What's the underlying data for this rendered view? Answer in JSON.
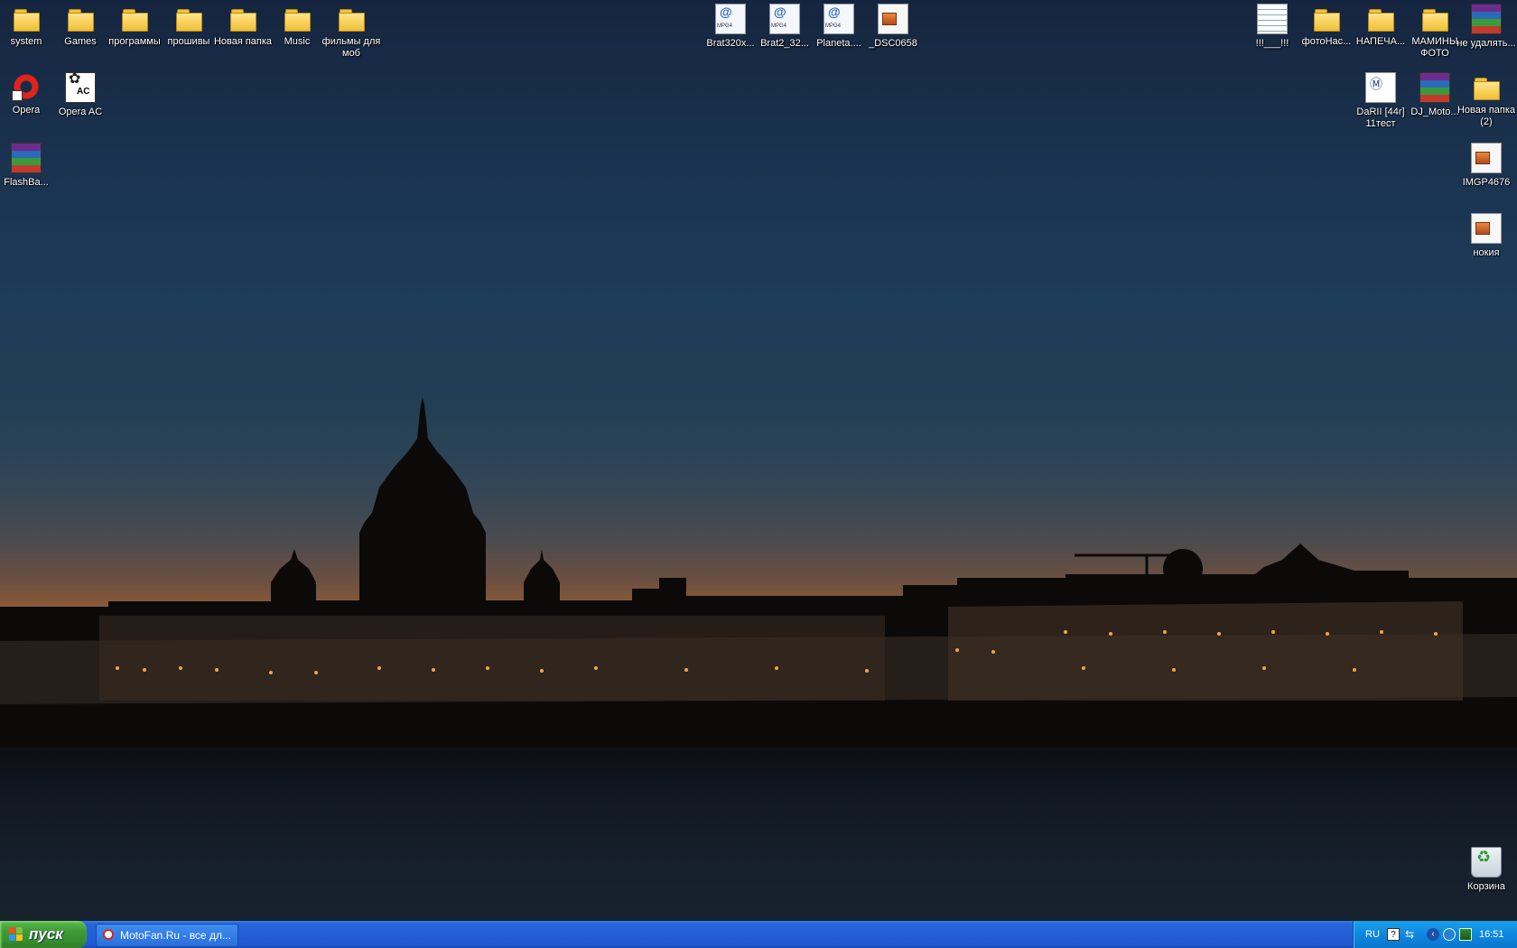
{
  "desktop": {
    "icons_left_top": [
      {
        "label": "system",
        "type": "folder"
      },
      {
        "label": "Games",
        "type": "folder"
      },
      {
        "label": "программы",
        "type": "folder"
      },
      {
        "label": "прошивы",
        "type": "folder"
      },
      {
        "label": "Новая папка",
        "type": "folder"
      },
      {
        "label": "Music",
        "type": "folder"
      },
      {
        "label": "фильмы для моб",
        "type": "folder"
      }
    ],
    "icons_left_col": [
      {
        "label": "Opera",
        "type": "opera"
      },
      {
        "label": "Opera AC",
        "type": "opera-ac"
      },
      {
        "label": "FlashBa...",
        "type": "rar"
      }
    ],
    "icons_center": [
      {
        "label": "Brat320x...",
        "type": "mpg"
      },
      {
        "label": "Brat2_32...",
        "type": "mpg"
      },
      {
        "label": "Planeta....",
        "type": "mpg"
      },
      {
        "label": "_DSC0658",
        "type": "image"
      }
    ],
    "icons_right_top": [
      {
        "label": "!!!___!!!",
        "type": "text"
      },
      {
        "label": "фотоНас...",
        "type": "folder"
      },
      {
        "label": "НАПЕЧА...",
        "type": "folder"
      },
      {
        "label": "МАМИНЫ ФОТО",
        "type": "folder"
      },
      {
        "label": "не удалять...",
        "type": "rar"
      }
    ],
    "icons_right_row2": [
      {
        "label": "DaRII [44r] 11тест",
        "type": "moto"
      },
      {
        "label": "DJ_Moto...",
        "type": "rar"
      },
      {
        "label": "Новая папка (2)",
        "type": "folder"
      }
    ],
    "icons_right_col": [
      {
        "label": "IMGP4676",
        "type": "image"
      },
      {
        "label": "нокия",
        "type": "image"
      }
    ],
    "recycle_bin": {
      "label": "Корзина"
    }
  },
  "taskbar": {
    "start_label": "пуск",
    "tasks": [
      {
        "label": "MotoFan.Ru - все дл..."
      }
    ],
    "tray": {
      "language": "RU",
      "clock": "16:51"
    }
  },
  "colors": {
    "taskbar_blue": "#245ed6",
    "start_green": "#3d9a34",
    "tray_blue": "#0f87df"
  }
}
